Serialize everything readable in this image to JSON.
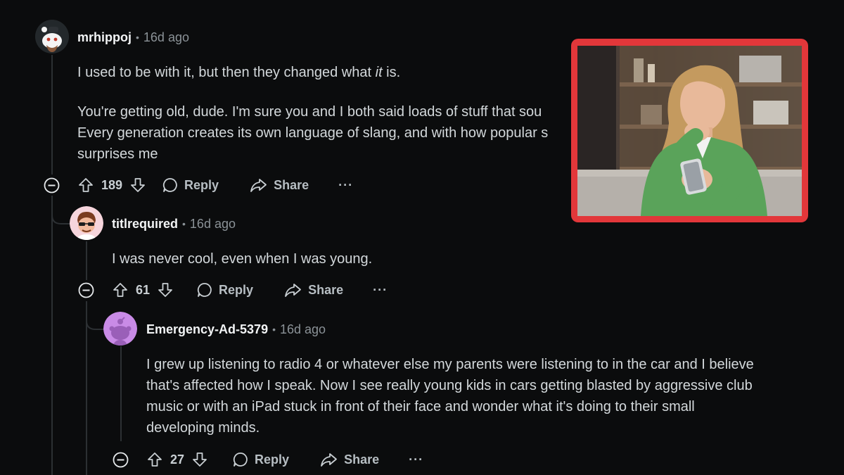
{
  "comments": [
    {
      "user": "mrhippoj",
      "separator": "•",
      "time": "16d ago",
      "body_line1_pre": "I used to be with it, but then they changed what ",
      "body_line1_em": "it",
      "body_line1_post": " is.",
      "body_line2": "You're getting old, dude. I'm sure you and I both said loads of stuff that sou",
      "body_line3": "Every generation creates its own language of slang, and with how popular s",
      "body_line4": "surprises me",
      "votes": "189",
      "reply_label": "Reply",
      "share_label": "Share",
      "more_label": "···"
    },
    {
      "user": "titlrequired",
      "separator": "•",
      "time": "16d ago",
      "body": "I was never cool, even when I was young.",
      "votes": "61",
      "reply_label": "Reply",
      "share_label": "Share",
      "more_label": "···"
    },
    {
      "user": "Emergency-Ad-5379",
      "separator": "•",
      "time": "16d ago",
      "body_lines": [
        "I grew up listening to radio 4 or whatever else my parents were listening to in the car and I believe",
        "that's affected how I speak. Now I see really young kids in cars getting blasted by aggressive club",
        "music or with an iPad stuck in front of their face and wonder what it's doing to their small",
        "developing minds."
      ],
      "votes": "27",
      "reply_label": "Reply",
      "share_label": "Share",
      "more_label": "···"
    }
  ],
  "colors": {
    "background": "#0b0c0d",
    "frame_accent": "#e2373a",
    "text": "#d3d8db",
    "muted": "#8b9297"
  },
  "icons": [
    "upvote-icon",
    "downvote-icon",
    "reply-bubble-icon",
    "share-arrow-icon",
    "collapse-minus-icon",
    "more-icon"
  ]
}
